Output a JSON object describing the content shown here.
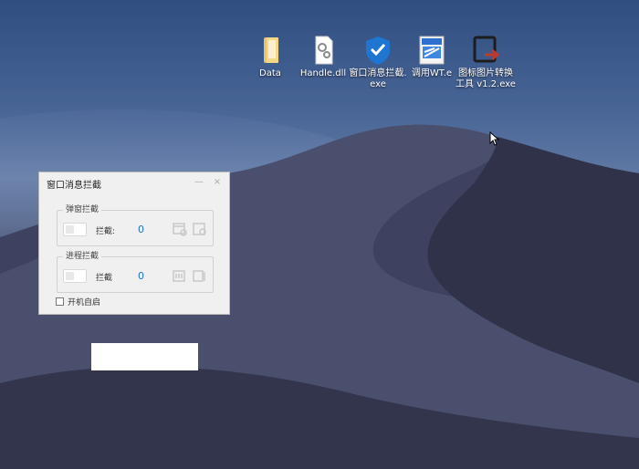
{
  "desktop": {
    "icons": [
      {
        "label": "Data",
        "icon": "folder-icon"
      },
      {
        "label": "Handle.dll",
        "icon": "dll-file-icon"
      },
      {
        "label": "窗口消息拦截.exe",
        "icon": "shield-app-icon"
      },
      {
        "label": "调用WT.e",
        "icon": "installer-app-icon"
      },
      {
        "label": "图标图片转换工具 v1.2.exe",
        "icon": "converter-app-icon"
      }
    ]
  },
  "window": {
    "title": "窗口消息拦截",
    "minimize_label": "—",
    "close_label": "×",
    "groups": [
      {
        "legend": "弹窗拦截",
        "row_label": "拦截:",
        "count": "0"
      },
      {
        "legend": "进程拦截",
        "row_label": "拦截",
        "count": "0"
      }
    ],
    "autostart_label": "开机自启",
    "autostart_checked": false
  },
  "colors": {
    "count_blue": "#1e73c8",
    "window_bg": "#f0f0f0"
  }
}
